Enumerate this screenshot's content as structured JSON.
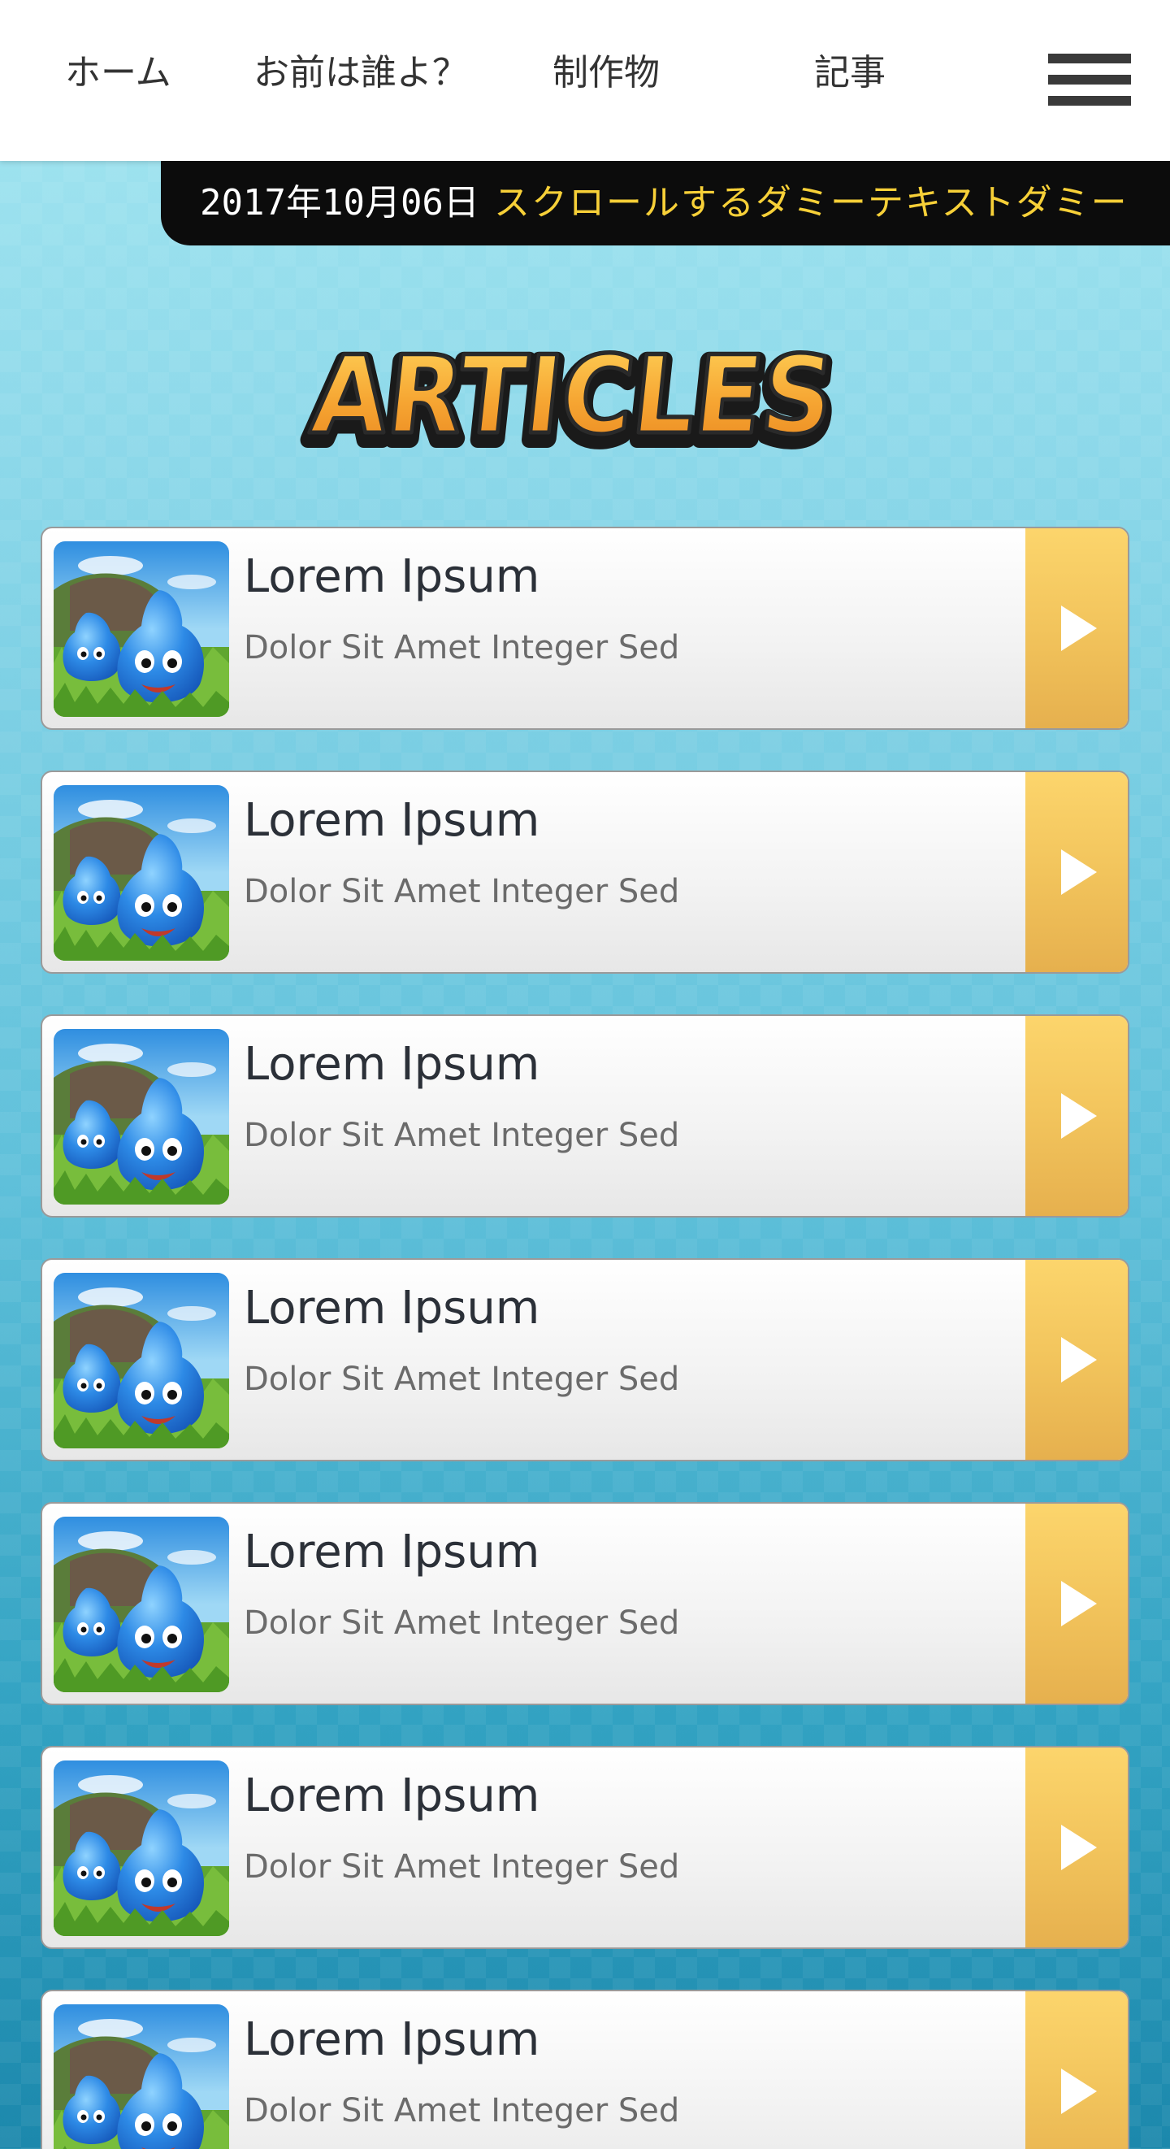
{
  "header": {
    "nav": [
      {
        "label": "ホーム"
      },
      {
        "label": "お前は誰よ？"
      },
      {
        "label": "制作物"
      },
      {
        "label": "記事"
      }
    ],
    "menu_icon": "hamburger-icon"
  },
  "ticker": {
    "date": "2017年10月06日",
    "text": "スクロールするダミーテキストダミー"
  },
  "section": {
    "heading": "ARTICLES"
  },
  "articles": [
    {
      "title": "Lorem Ipsum",
      "subtitle": "Dolor Sit Amet Integer Sed"
    },
    {
      "title": "Lorem Ipsum",
      "subtitle": "Dolor Sit Amet Integer Sed"
    },
    {
      "title": "Lorem Ipsum",
      "subtitle": "Dolor Sit Amet Integer Sed"
    },
    {
      "title": "Lorem Ipsum",
      "subtitle": "Dolor Sit Amet Integer Sed"
    },
    {
      "title": "Lorem Ipsum",
      "subtitle": "Dolor Sit Amet Integer Sed"
    },
    {
      "title": "Lorem Ipsum",
      "subtitle": "Dolor Sit Amet Integer Sed"
    },
    {
      "title": "Lorem Ipsum",
      "subtitle": "Dolor Sit Amet Integer Sed"
    }
  ],
  "colors": {
    "accent": "#f2c45c",
    "ticker_bg": "#0c0c0c",
    "ticker_text": "#f7d038",
    "sky_top": "#a6e7f1",
    "sky_bottom": "#1c88ac"
  }
}
